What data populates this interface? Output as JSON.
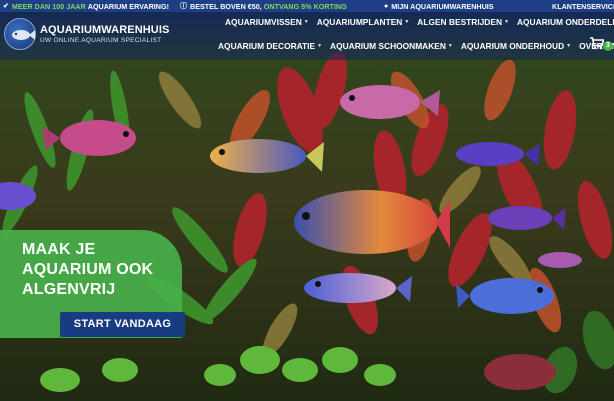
{
  "topbar": {
    "free_shipping_prefix": "MEER DAN 100 JAAR",
    "free_shipping_text": "AQUARIUM ERVARING!",
    "discount_prefix": "BESTEL BOVEN €50,",
    "discount_highlight": "ONTVANG 5% KORTING",
    "account_label": "MIJN AQUARIUMWARENHUIS",
    "service_label": "KLANTENSERVICE"
  },
  "brand": {
    "name": "AQUARIUMWARENHUIS",
    "tagline": "UW ONLINE AQUARIUM SPECIALIST"
  },
  "nav": {
    "row1": [
      {
        "label": "AQUARIUMVISSEN",
        "caret": true
      },
      {
        "label": "AQUARIUMPLANTEN",
        "caret": true
      },
      {
        "label": "ALGEN BESTRIJDEN",
        "caret": true
      },
      {
        "label": "AQUARIUM ONDERDELEN",
        "caret": true
      }
    ],
    "row2": [
      {
        "label": "AQUARIUM DECORATIE",
        "caret": true
      },
      {
        "label": "AQUARIUM SCHOONMAKEN",
        "caret": true
      },
      {
        "label": "AQUARIUM ONDERHOUD",
        "caret": true
      },
      {
        "label": "OVER ONS",
        "caret": false
      }
    ]
  },
  "cart": {
    "icon": "cart-icon",
    "count": "3"
  },
  "promo": {
    "title": "MAAK JE AQUARIUM OOK ALGENVRIJ",
    "button_label": "START VANDAAG"
  },
  "colors": {
    "topbar": "#1e3f86",
    "accent_green": "#46b04a",
    "button_blue": "#173c7f"
  }
}
